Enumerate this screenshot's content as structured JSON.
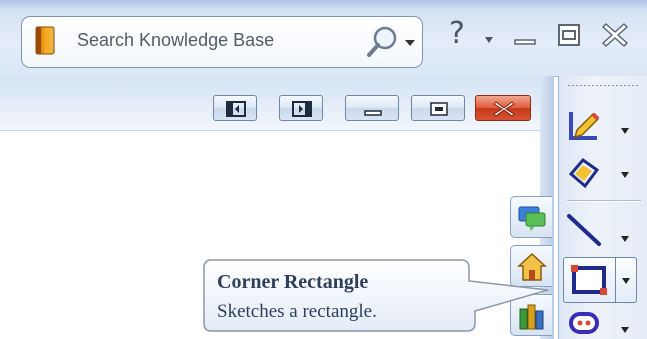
{
  "search": {
    "placeholder": "Search Knowledge Base"
  },
  "titlebar": {
    "help_glyph": "?"
  },
  "icons": {
    "book": "book-icon",
    "search": "magnifier-icon",
    "help": "help-icon",
    "minimize": "minimize-icon",
    "maximize": "maximize-icon",
    "close": "close-icon"
  },
  "tooltip": {
    "title": "Corner Rectangle",
    "description": "Sketches a rectangle."
  },
  "sketch_toolbar": {
    "tools": [
      {
        "name": "sketch-icon"
      },
      {
        "name": "smart-dimension-icon"
      },
      {
        "name": "line-icon"
      },
      {
        "name": "corner-rectangle-icon",
        "selected": true
      },
      {
        "name": "slot-icon"
      }
    ]
  },
  "task_pane": {
    "tabs": [
      {
        "name": "resources-icon"
      },
      {
        "name": "home-icon"
      },
      {
        "name": "design-library-icon"
      }
    ]
  },
  "colors": {
    "accent_blue": "#c9d9ee",
    "close_red": "#d65330",
    "tooltip_text": "#2e3f5c"
  }
}
